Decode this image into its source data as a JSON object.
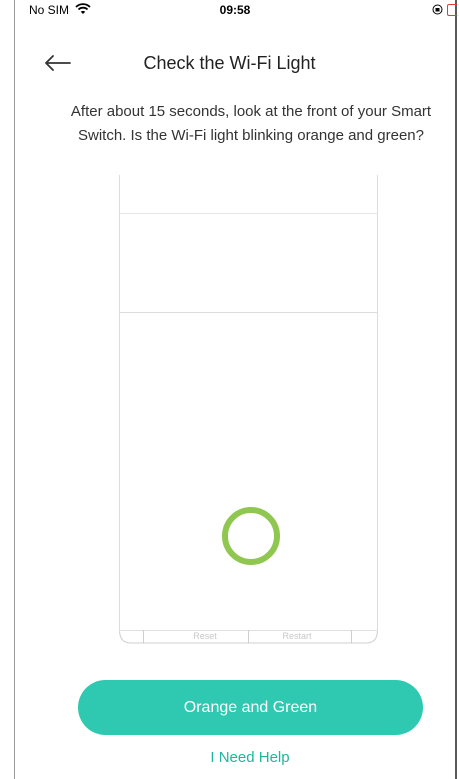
{
  "status_bar": {
    "carrier": "No SIM",
    "time": "09:58"
  },
  "header": {
    "title": "Check the Wi-Fi Light",
    "back_icon": "arrow-left-icon"
  },
  "instruction": "After about 15 seconds, look at the front of your Smart Switch. Is the Wi-Fi light blinking orange and green?",
  "device": {
    "reset_label": "Reset",
    "restart_label": "Restart",
    "led_color": "#8fc750"
  },
  "actions": {
    "primary_label": "Orange and Green",
    "help_label": "I Need Help"
  },
  "colors": {
    "accent": "#2ec9b0",
    "link": "#20b69c"
  }
}
